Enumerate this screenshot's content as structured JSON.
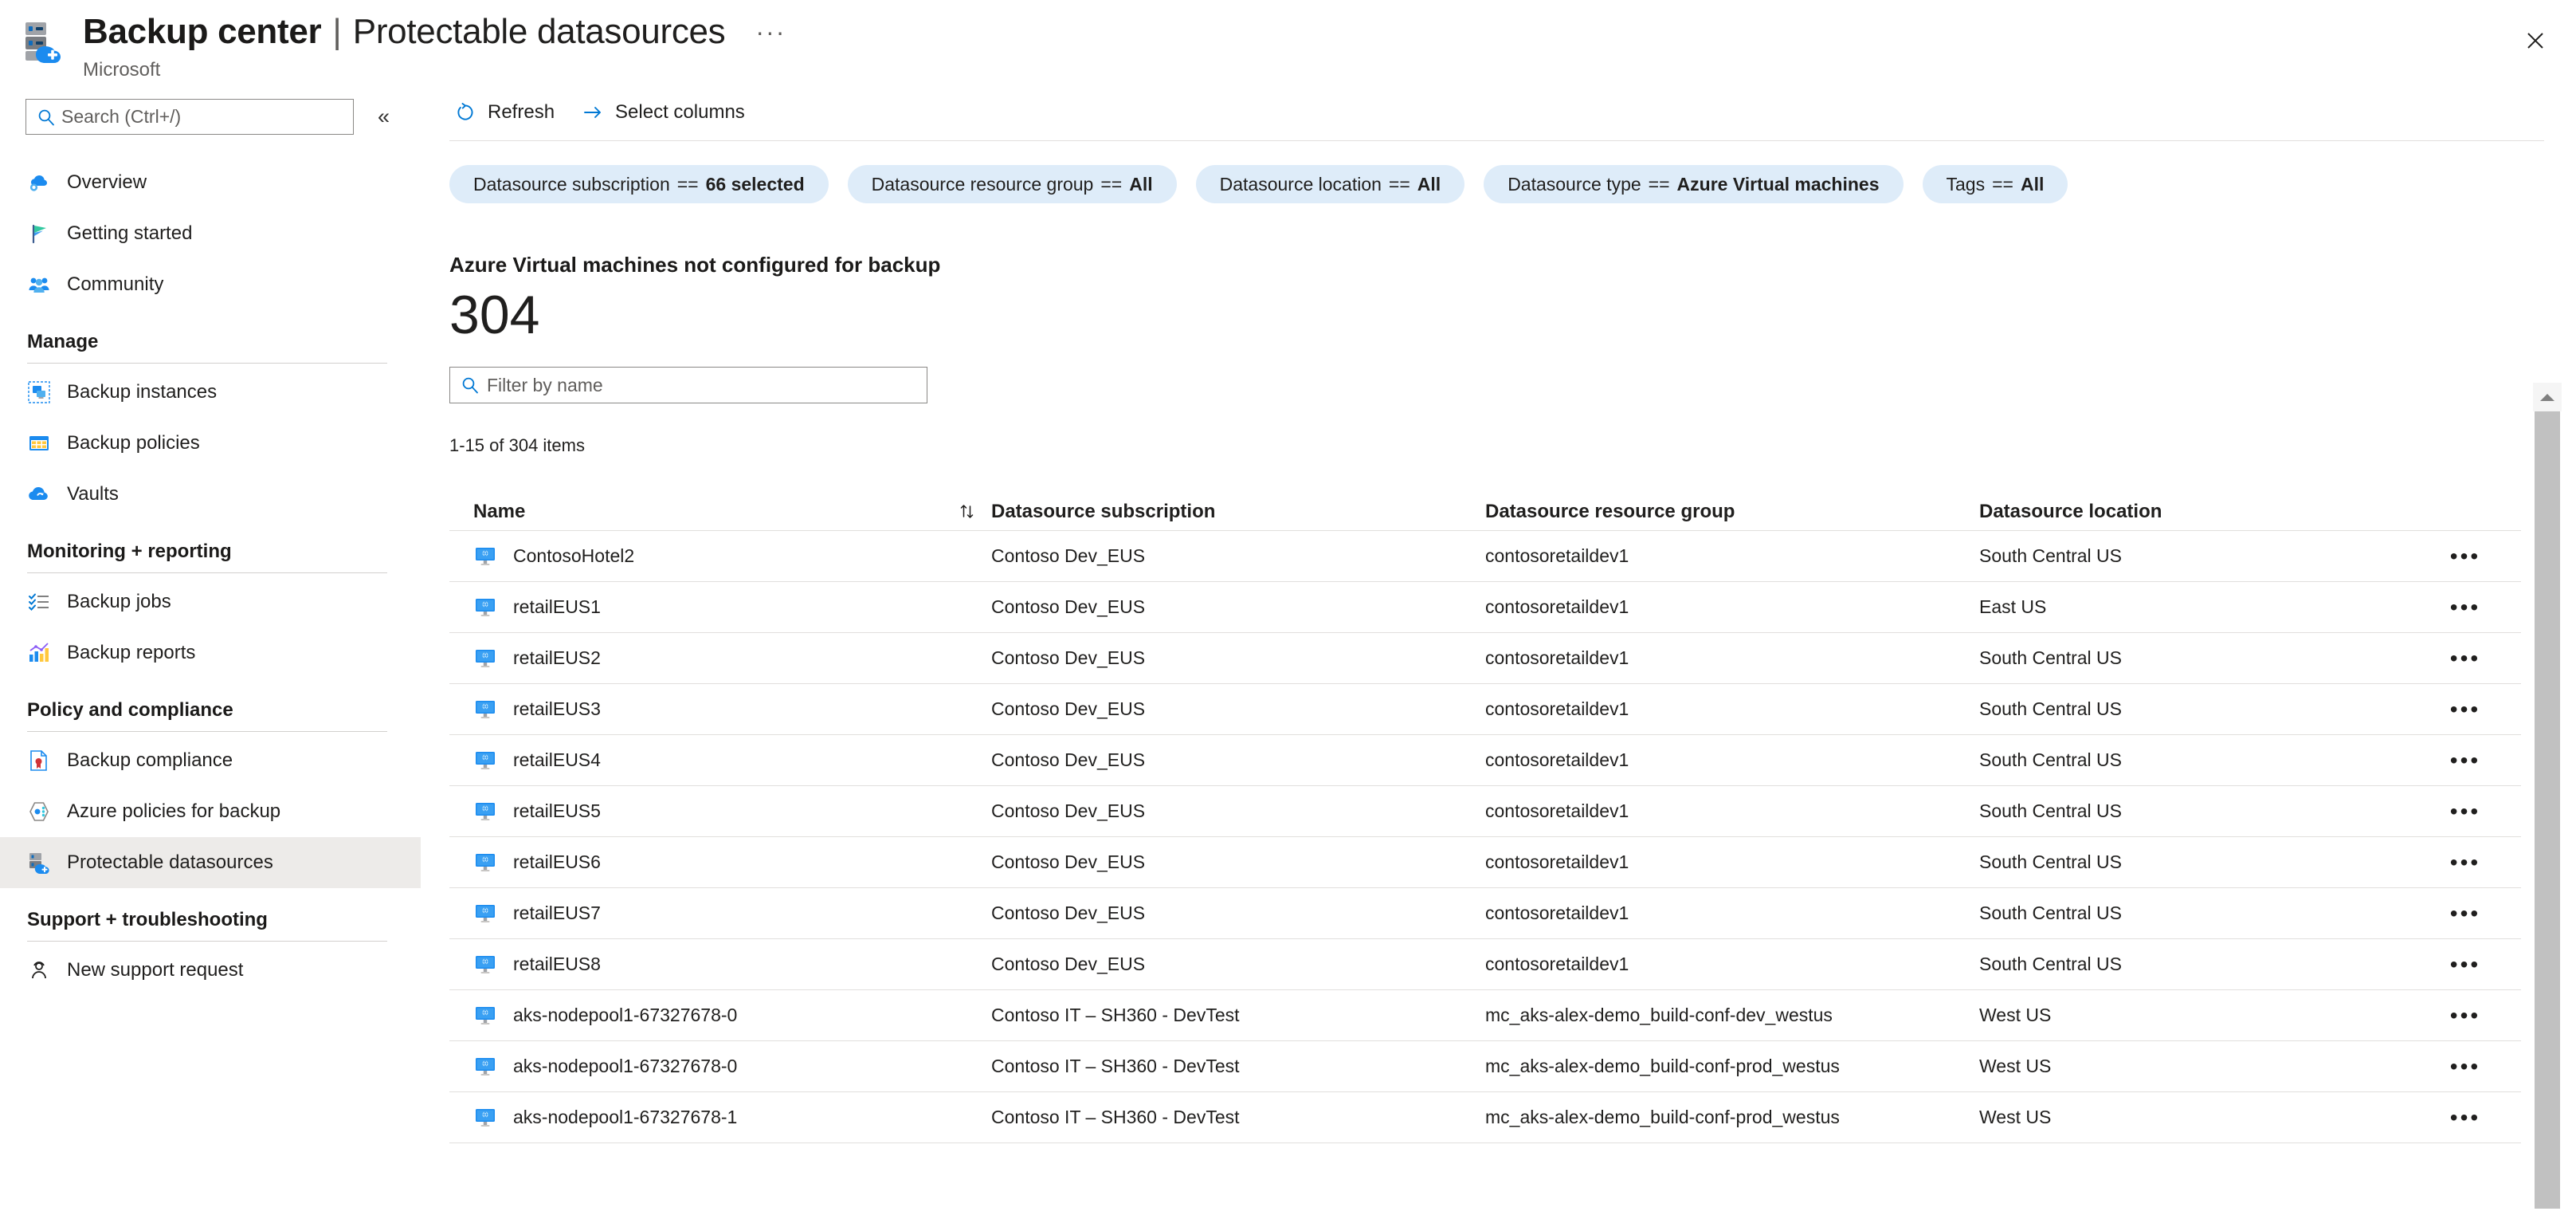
{
  "header": {
    "title_main": "Backup center",
    "separator": "|",
    "title_sub": "Protectable datasources",
    "ellipsis": "···",
    "publisher": "Microsoft",
    "app_icon": "backup-center-icon",
    "close_icon": "close-icon"
  },
  "sidebar": {
    "search": {
      "placeholder": "Search (Ctrl+/)",
      "value": "",
      "icon": "search-icon"
    },
    "collapse_label": "«",
    "top_items": [
      {
        "label": "Overview",
        "icon": "cloud-overview-icon"
      },
      {
        "label": "Getting started",
        "icon": "flag-icon"
      },
      {
        "label": "Community",
        "icon": "community-people-icon"
      }
    ],
    "groups": [
      {
        "title": "Manage",
        "items": [
          {
            "label": "Backup instances",
            "icon": "backup-instances-icon"
          },
          {
            "label": "Backup policies",
            "icon": "backup-policies-icon"
          },
          {
            "label": "Vaults",
            "icon": "vaults-cloud-icon"
          }
        ]
      },
      {
        "title": "Monitoring + reporting",
        "items": [
          {
            "label": "Backup jobs",
            "icon": "checklist-icon"
          },
          {
            "label": "Backup reports",
            "icon": "bar-chart-icon"
          }
        ]
      },
      {
        "title": "Policy and compliance",
        "items": [
          {
            "label": "Backup compliance",
            "icon": "document-seal-icon"
          },
          {
            "label": "Azure policies for backup",
            "icon": "policy-hexagon-icon"
          },
          {
            "label": "Protectable datasources",
            "icon": "protectable-datasources-icon",
            "selected": true
          }
        ]
      },
      {
        "title": "Support + troubleshooting",
        "items": [
          {
            "label": "New support request",
            "icon": "support-person-icon"
          }
        ]
      }
    ]
  },
  "toolbar": {
    "refresh_label": "Refresh",
    "refresh_icon": "refresh-icon",
    "select_columns_label": "Select columns",
    "select_columns_icon": "arrow-right-icon"
  },
  "filters": [
    {
      "name": "Datasource subscription",
      "op": "==",
      "value": "66 selected"
    },
    {
      "name": "Datasource resource group",
      "op": "==",
      "value": "All"
    },
    {
      "name": "Datasource location",
      "op": "==",
      "value": "All"
    },
    {
      "name": "Datasource type",
      "op": "==",
      "value": "Azure Virtual machines"
    },
    {
      "name": "Tags",
      "op": "==",
      "value": "All"
    }
  ],
  "summary": {
    "section_title": "Azure Virtual machines not configured for backup",
    "count": "304"
  },
  "filter_by_name": {
    "placeholder": "Filter by name",
    "value": "",
    "icon": "search-icon"
  },
  "table": {
    "item_count_text": "1-15 of 304 items",
    "sort_icon": "sort-updown-icon",
    "row_menu_icon": "ellipsis-icon",
    "row_icon": "virtual-machine-icon",
    "columns": [
      "Name",
      "Datasource subscription",
      "Datasource resource group",
      "Datasource location"
    ],
    "rows": [
      {
        "name": "ContosoHotel2",
        "subscription": "Contoso Dev_EUS",
        "resource_group": "contosoretaildev1",
        "location": "South Central US"
      },
      {
        "name": "retailEUS1",
        "subscription": "Contoso Dev_EUS",
        "resource_group": "contosoretaildev1",
        "location": "East US"
      },
      {
        "name": "retailEUS2",
        "subscription": "Contoso Dev_EUS",
        "resource_group": "contosoretaildev1",
        "location": "South Central US"
      },
      {
        "name": "retailEUS3",
        "subscription": "Contoso Dev_EUS",
        "resource_group": "contosoretaildev1",
        "location": "South Central US"
      },
      {
        "name": "retailEUS4",
        "subscription": "Contoso Dev_EUS",
        "resource_group": "contosoretaildev1",
        "location": "South Central US"
      },
      {
        "name": "retailEUS5",
        "subscription": "Contoso Dev_EUS",
        "resource_group": "contosoretaildev1",
        "location": "South Central US"
      },
      {
        "name": "retailEUS6",
        "subscription": "Contoso Dev_EUS",
        "resource_group": "contosoretaildev1",
        "location": "South Central US"
      },
      {
        "name": "retailEUS7",
        "subscription": "Contoso Dev_EUS",
        "resource_group": "contosoretaildev1",
        "location": "South Central US"
      },
      {
        "name": "retailEUS8",
        "subscription": "Contoso Dev_EUS",
        "resource_group": "contosoretaildev1",
        "location": "South Central US"
      },
      {
        "name": "aks-nodepool1-67327678-0",
        "subscription": "Contoso IT – SH360 - DevTest",
        "resource_group": "mc_aks-alex-demo_build-conf-dev_westus",
        "location": "West US"
      },
      {
        "name": "aks-nodepool1-67327678-0",
        "subscription": "Contoso IT – SH360 - DevTest",
        "resource_group": "mc_aks-alex-demo_build-conf-prod_westus",
        "location": "West US"
      },
      {
        "name": "aks-nodepool1-67327678-1",
        "subscription": "Contoso IT – SH360 - DevTest",
        "resource_group": "mc_aks-alex-demo_build-conf-prod_westus",
        "location": "West US"
      }
    ]
  },
  "colors": {
    "accent": "#0078d4",
    "pill_bg": "#deecf9",
    "selected_nav": "#edebe9",
    "border": "#e1dfdd"
  }
}
